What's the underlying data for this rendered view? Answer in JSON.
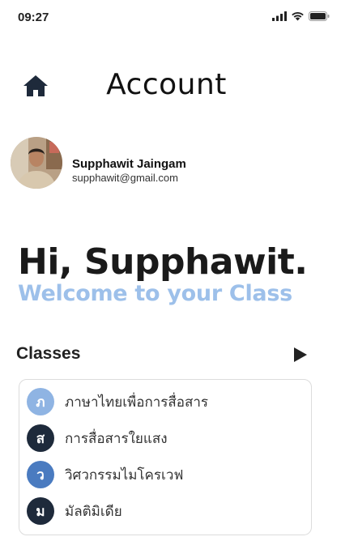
{
  "status_bar": {
    "time": "09:27",
    "icons": [
      "signal-icon",
      "wifi-icon",
      "battery-icon"
    ]
  },
  "header": {
    "title": "Account",
    "home_icon": "home-icon"
  },
  "profile": {
    "name": "Supphawit Jaingam",
    "email": "supphawit@gmail.com"
  },
  "hero": {
    "greeting": "Hi, Supphawit.",
    "welcome": "Welcome to your Class"
  },
  "classes": {
    "title": "Classes",
    "arrow_icon": "play-icon",
    "items": [
      {
        "initial": "ภ",
        "name": "ภาษาไทยเพื่อการสื่อสาร",
        "color": "#8fb4e3"
      },
      {
        "initial": "ส",
        "name": "การสื่อสารใยแสง",
        "color": "#1e2a3b"
      },
      {
        "initial": "ว",
        "name": "วิศวกรรมไมโครเวฟ",
        "color": "#4a7bc0"
      },
      {
        "initial": "ม",
        "name": "มัลติมิเดีย",
        "color": "#1e2a3b"
      }
    ]
  },
  "colors": {
    "accent": "#9dc0ea",
    "dark": "#1e2a3b",
    "home_icon": "#1e2a3b"
  }
}
